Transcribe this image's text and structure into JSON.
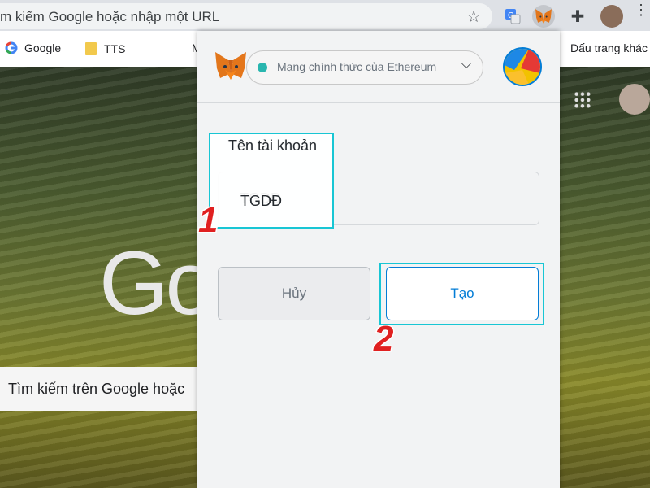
{
  "browser": {
    "omnibox_text": "m kiếm Google hoặc nhập một URL",
    "bookmarks": {
      "google": "Google",
      "tts": "TTS",
      "partial": "M",
      "right": "Dấu trang khác"
    }
  },
  "ntp": {
    "logo_text": "Go",
    "search_placeholder": "Tìm kiếm trên Google hoặc"
  },
  "metamask": {
    "network_label": "Mạng chính thức của Ethereum",
    "account_name_label": "Tên tài khoản",
    "account_name_value": "TGDĐ",
    "cancel_label": "Hủy",
    "create_label": "Tạo"
  },
  "annotations": {
    "step1": "1",
    "step2": "2"
  },
  "colors": {
    "accent": "#037dd6",
    "highlight": "#18c6d4",
    "step_number": "#e02020",
    "network_dot": "#29b6af"
  }
}
